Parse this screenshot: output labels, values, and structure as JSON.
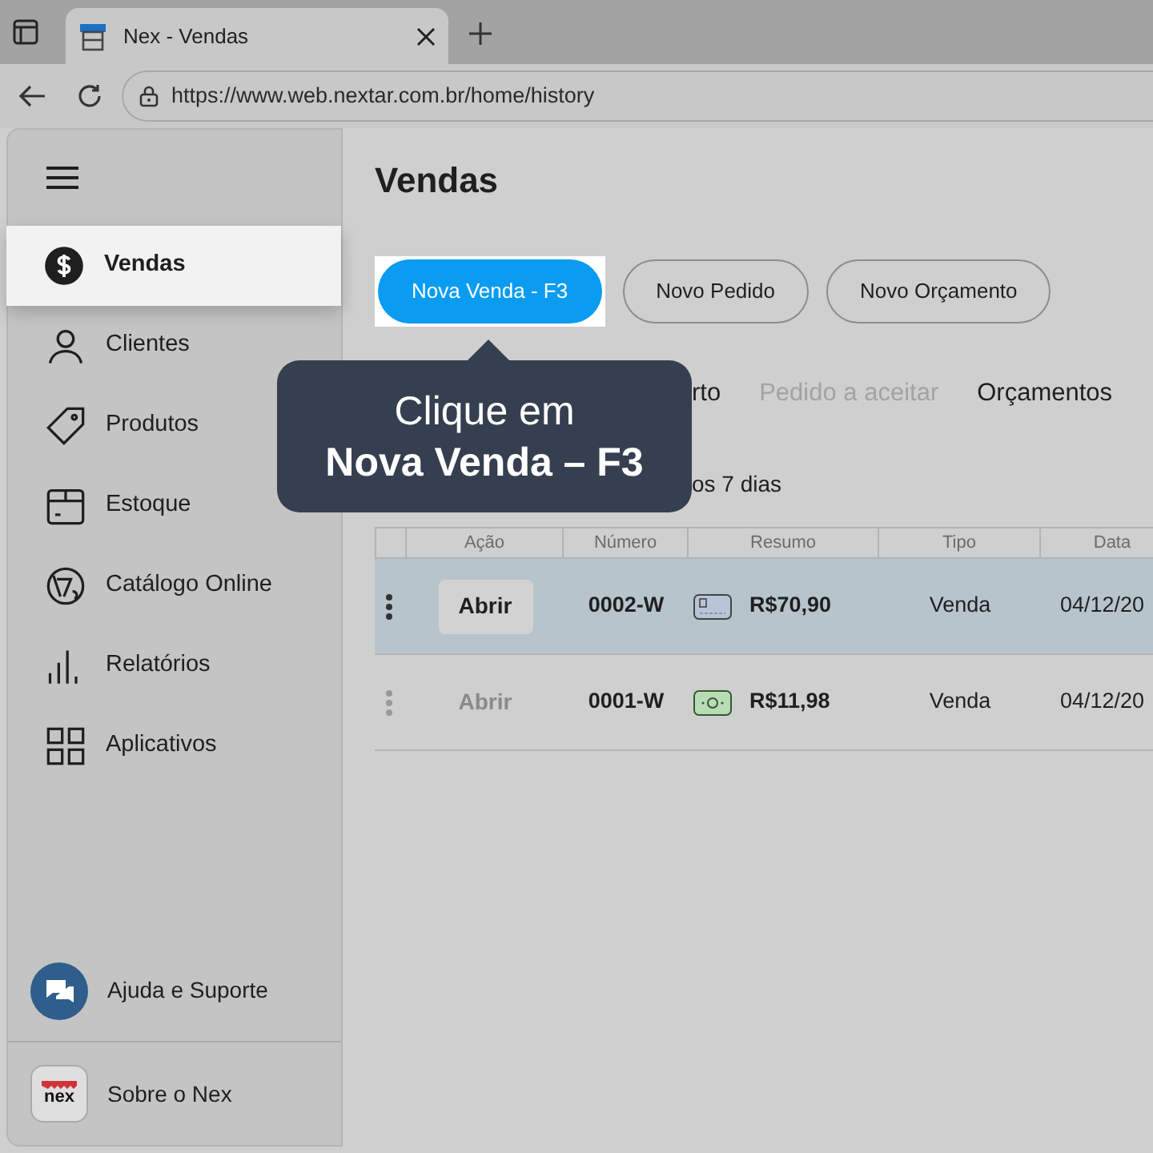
{
  "browser": {
    "tab_title": "Nex - Vendas",
    "url": "https://www.web.nextar.com.br/home/history"
  },
  "sidebar": {
    "items": [
      {
        "label": "Vendas",
        "kind": "dollar",
        "selected": true
      },
      {
        "label": "Clientes",
        "kind": "user",
        "selected": false
      },
      {
        "label": "Produtos",
        "kind": "tag",
        "selected": false
      },
      {
        "label": "Estoque",
        "kind": "box",
        "selected": false
      },
      {
        "label": "Catálogo Online",
        "kind": "catalog",
        "selected": false
      },
      {
        "label": "Relatórios",
        "kind": "bars",
        "selected": false
      },
      {
        "label": "Aplicativos",
        "kind": "grid",
        "selected": false
      }
    ],
    "help": "Ajuda e Suporte",
    "about": "Sobre o Nex",
    "logo": "nex"
  },
  "page": {
    "title": "Vendas",
    "buttons": [
      {
        "label": "Nova Venda - F3",
        "kind": "primary"
      },
      {
        "label": "Novo Pedido",
        "kind": "outline"
      },
      {
        "label": "Novo Orçamento",
        "kind": "outline"
      }
    ],
    "tabs": [
      {
        "label": "rto",
        "disabled": false
      },
      {
        "label": "Pedido a aceitar",
        "disabled": true
      },
      {
        "label": "Orçamentos",
        "disabled": false
      }
    ],
    "filter": "os 7 dias",
    "table": {
      "columns": [
        "Ação",
        "Número",
        "Resumo",
        "Tipo",
        "Data"
      ],
      "rows": [
        {
          "selected": true,
          "action": "Abrir",
          "number": "0002-W",
          "kind": "card",
          "total": "R$70,90",
          "type": "Venda",
          "date": "04/12/20"
        },
        {
          "selected": false,
          "action": "Abrir",
          "number": "0001-W",
          "kind": "cash",
          "total": "R$11,98",
          "type": "Venda",
          "date": "04/12/20"
        }
      ]
    }
  },
  "tooltip": {
    "line_1": "Clique em",
    "line_2": "Nova Venda – F3"
  }
}
